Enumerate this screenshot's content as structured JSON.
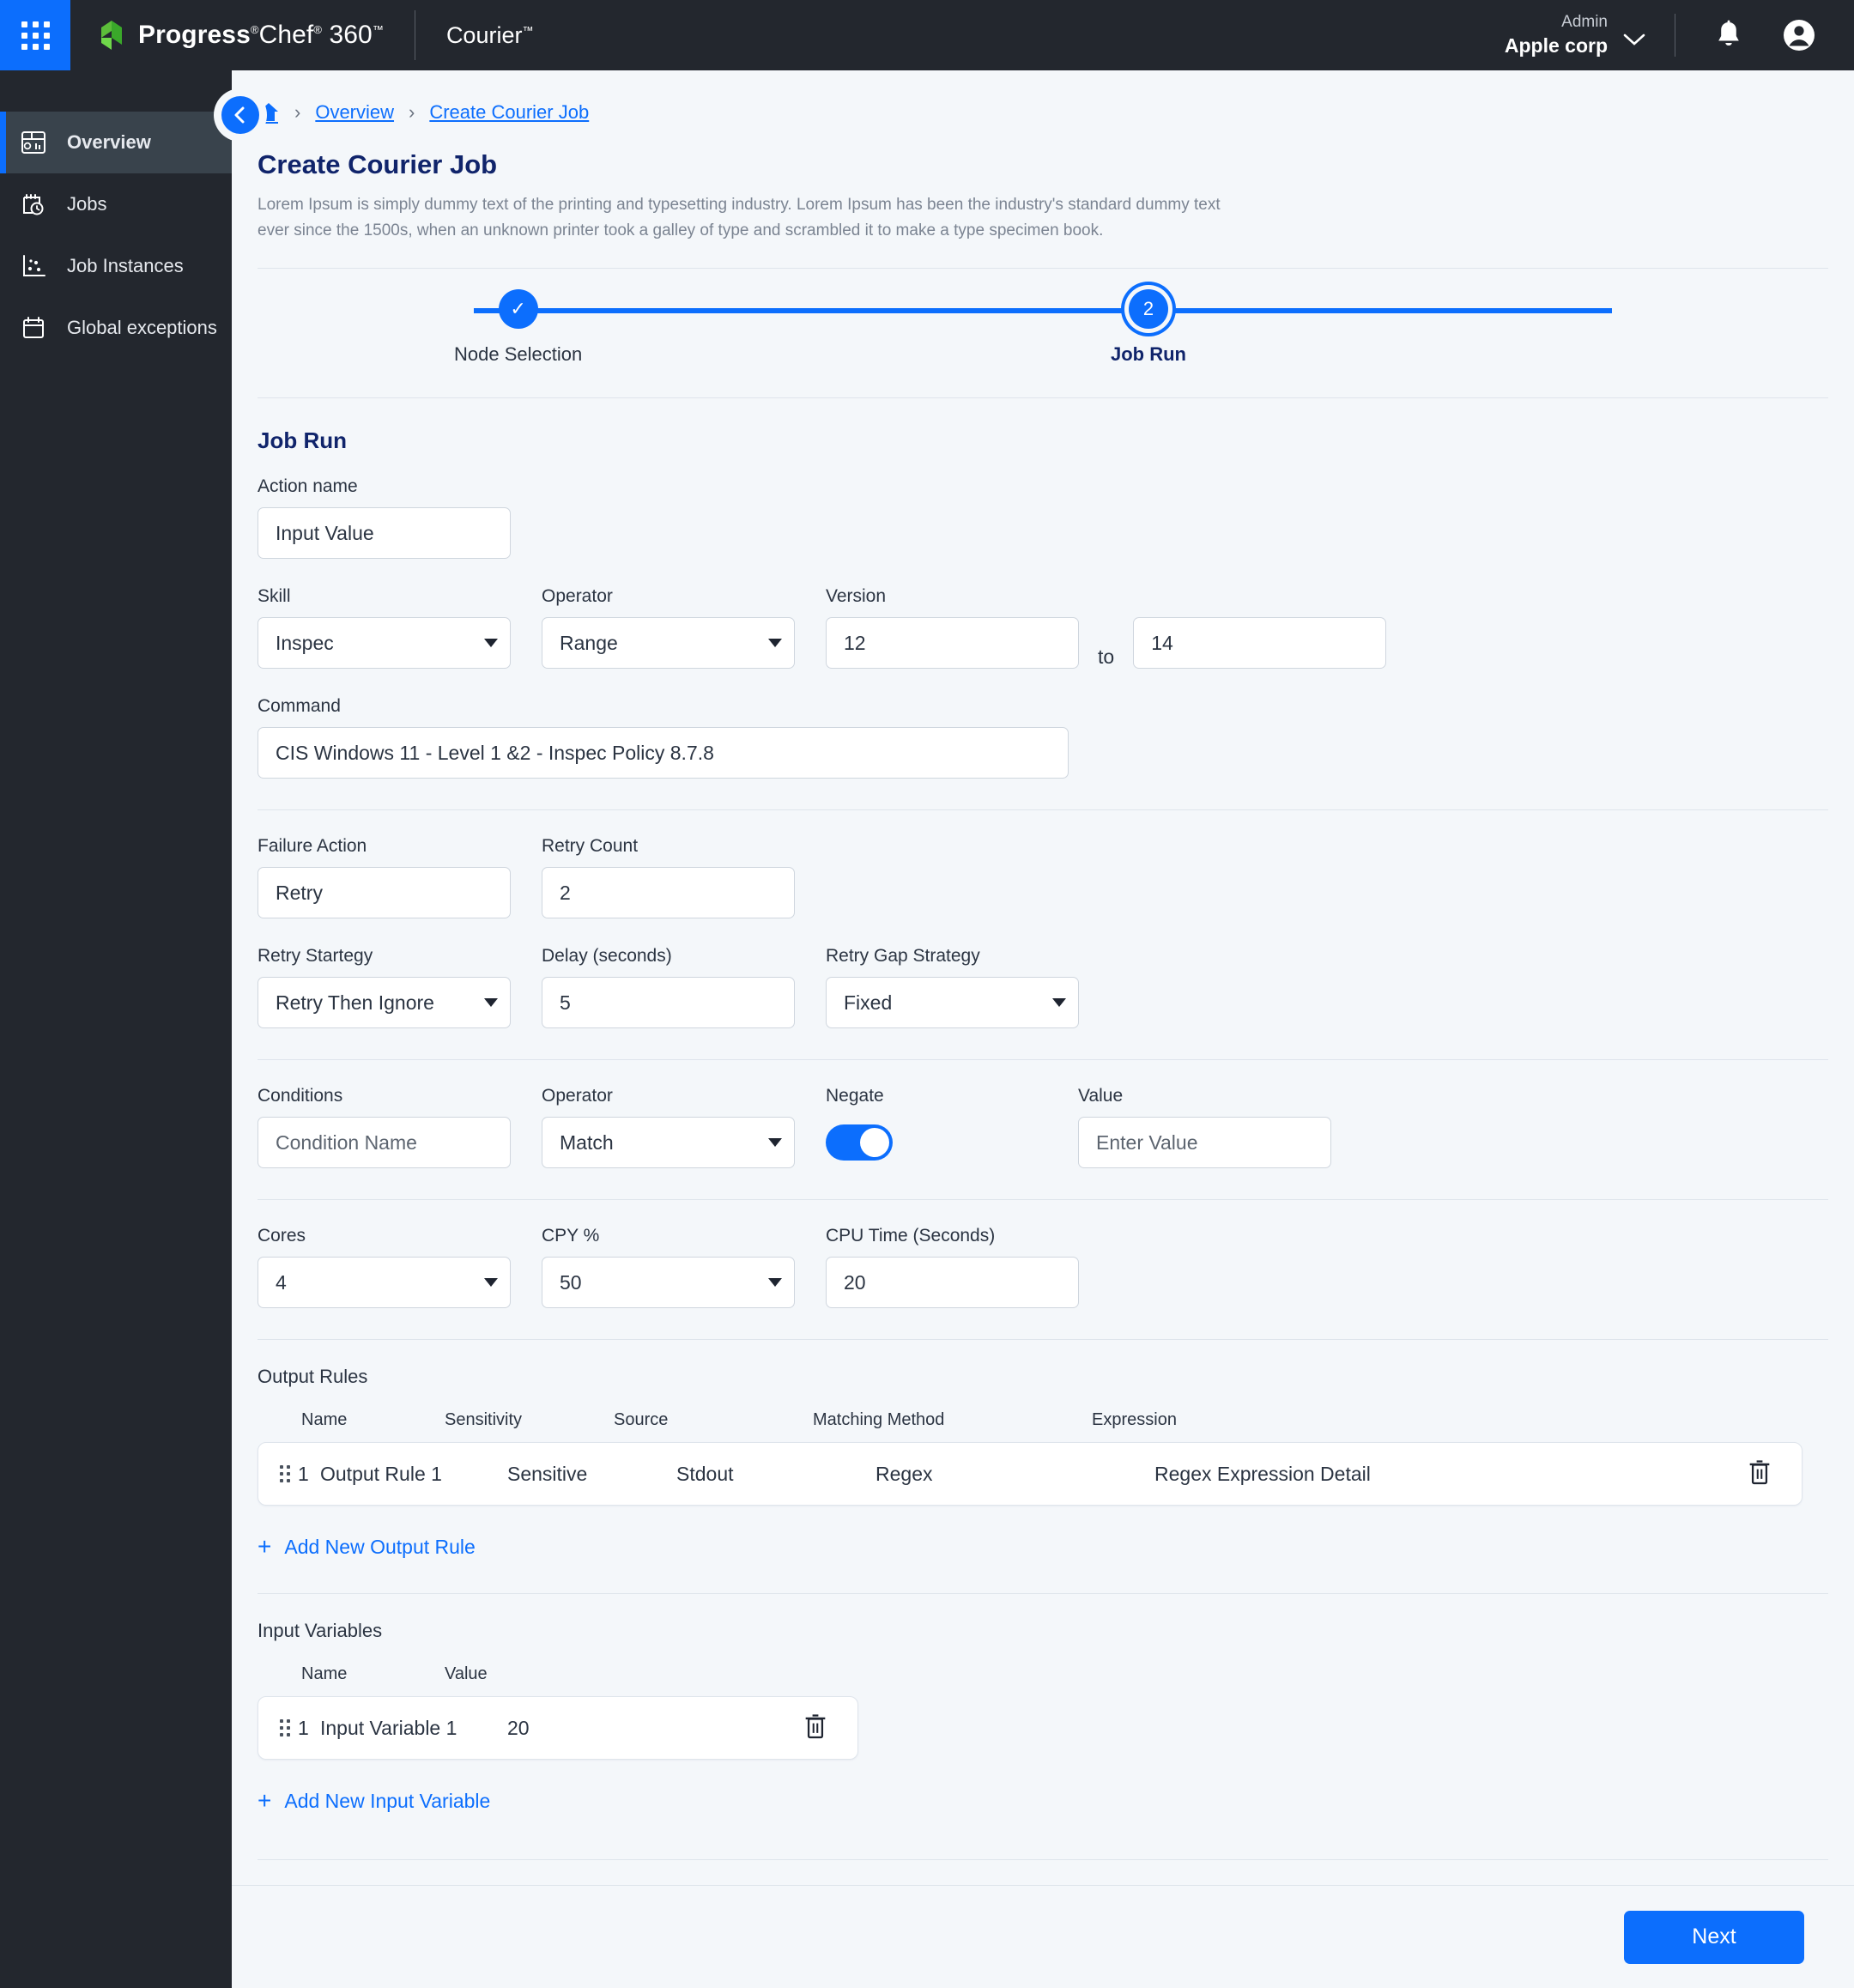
{
  "topbar": {
    "waffle": "apps-grid-icon",
    "brand_progress": "Progress",
    "brand_chef": "Chef",
    "brand_360": "360",
    "product": "Courier",
    "tm": "™",
    "reg": "®",
    "org_role": "Admin",
    "org_name": "Apple corp",
    "notifications_icon": "bell-icon",
    "account_icon": "account-circle-icon"
  },
  "sidebar": {
    "items": [
      {
        "label": "Overview",
        "icon": "dashboard-icon",
        "active": true
      },
      {
        "label": "Jobs",
        "icon": "calendar-clock-icon",
        "active": false
      },
      {
        "label": "Job Instances",
        "icon": "scatter-plot-icon",
        "active": false
      },
      {
        "label": "Global exceptions",
        "icon": "calendar-icon",
        "active": false
      }
    ]
  },
  "breadcrumb": {
    "home_icon": "home-icon",
    "separator": "›",
    "items": [
      "Overview",
      "Create Courier Job"
    ]
  },
  "page": {
    "title": "Create Courier Job",
    "description": "Lorem Ipsum is simply dummy text of the printing and typesetting industry. Lorem Ipsum has been the industry's standard dummy text ever since the 1500s, when an unknown printer took a galley of type and scrambled it to make a type specimen book."
  },
  "stepper": {
    "steps": [
      {
        "label": "Node Selection",
        "marker": "✓",
        "state": "completed"
      },
      {
        "label": "Job Run",
        "marker": "2",
        "state": "active"
      }
    ]
  },
  "form": {
    "section_title": "Job Run",
    "action_name": {
      "label": "Action name",
      "value": "Input Value",
      "placeholder": "Input Value"
    },
    "skill": {
      "label": "Skill",
      "value": "Inspec"
    },
    "operator_version": {
      "label": "Operator",
      "value": "Range"
    },
    "version": {
      "label": "Version",
      "from": "12",
      "to_word": "to",
      "to": "14"
    },
    "command": {
      "label": "Command",
      "value": "CIS Windows 11 - Level 1 &2 - Inspec Policy 8.7.8"
    },
    "failure_action": {
      "label": "Failure Action",
      "value": "Retry"
    },
    "retry_count": {
      "label": "Retry Count",
      "value": "2"
    },
    "retry_strategy": {
      "label": "Retry Startegy",
      "value": "Retry Then Ignore"
    },
    "delay": {
      "label": "Delay (seconds)",
      "value": "5"
    },
    "retry_gap_strategy": {
      "label": "Retry Gap Strategy",
      "value": "Fixed"
    },
    "conditions": {
      "label": "Conditions",
      "value": "Condition Name",
      "placeholder": "Condition Name"
    },
    "condition_operator": {
      "label": "Operator",
      "value": "Match"
    },
    "negate": {
      "label": "Negate",
      "state": "on"
    },
    "condition_value": {
      "label": "Value",
      "value": "Enter Value",
      "placeholder": "Enter Value"
    },
    "cores": {
      "label": "Cores",
      "value": "4"
    },
    "cpy": {
      "label": "CPY %",
      "value": "50"
    },
    "cpu_time": {
      "label": "CPU Time (Seconds)",
      "value": "20"
    }
  },
  "output_rules": {
    "title": "Output Rules",
    "columns": [
      "Name",
      "Sensitivity",
      "Source",
      "Matching Method",
      "Expression"
    ],
    "rows": [
      {
        "index": "1",
        "name": "Output Rule 1",
        "sensitivity": "Sensitive",
        "source": "Stdout",
        "matching_method": "Regex",
        "expression": "Regex Expression Detail",
        "delete_icon": "trash-icon",
        "drag_icon": "drag-handle-icon"
      }
    ],
    "add_label": "Add New Output Rule",
    "add_plus": "+"
  },
  "input_variables": {
    "title": "Input Variables",
    "columns": [
      "Name",
      "Value"
    ],
    "rows": [
      {
        "index": "1",
        "name": "Input Variable 1",
        "value": "20",
        "delete_icon": "trash-icon",
        "drag_icon": "drag-handle-icon"
      }
    ],
    "add_label": "Add New Input Variable",
    "add_plus": "+"
  },
  "footer": {
    "next_label": "Next"
  },
  "colors": {
    "accent": "#0c6efd",
    "header_bg": "#23272e",
    "page_bg": "#f4f7fa",
    "title": "#10246b",
    "green": "#5cbd3a"
  }
}
